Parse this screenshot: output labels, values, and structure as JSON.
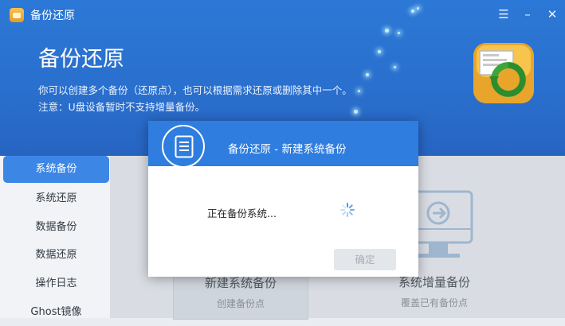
{
  "window": {
    "title": "备份还原",
    "controls": {
      "menu": "☰",
      "minimize": "–",
      "close": "✕"
    }
  },
  "header": {
    "heading": "备份还原",
    "line1": "你可以创建多个备份（还原点），也可以根据需求还原或删除其中一个。",
    "line2": "注意：U盘设备暂时不支持增量备份。",
    "icon": "backup-restore-icon"
  },
  "sidebar": {
    "items": [
      {
        "label": "系统备份",
        "active": true
      },
      {
        "label": "系统还原",
        "active": false
      },
      {
        "label": "数据备份",
        "active": false
      },
      {
        "label": "数据还原",
        "active": false
      },
      {
        "label": "操作日志",
        "active": false
      },
      {
        "label": "Ghost镜像",
        "active": false
      }
    ]
  },
  "cards": [
    {
      "title": "新建系统备份",
      "subtitle": "创建备份点",
      "icon": "new-backup-icon"
    },
    {
      "title": "系统增量备份",
      "subtitle": "覆盖已有备份点",
      "icon": "incremental-backup-icon"
    }
  ],
  "dialog": {
    "title": "备份还原 - 新建系统备份",
    "message": "正在备份系统...",
    "ok_label": "确定",
    "icon": "document-icon",
    "spinner": "loading-spinner-icon"
  },
  "colors": {
    "header_blue": "#2a6fcd",
    "accent": "#3c86e6",
    "dialog_header": "#2f7ddf"
  }
}
